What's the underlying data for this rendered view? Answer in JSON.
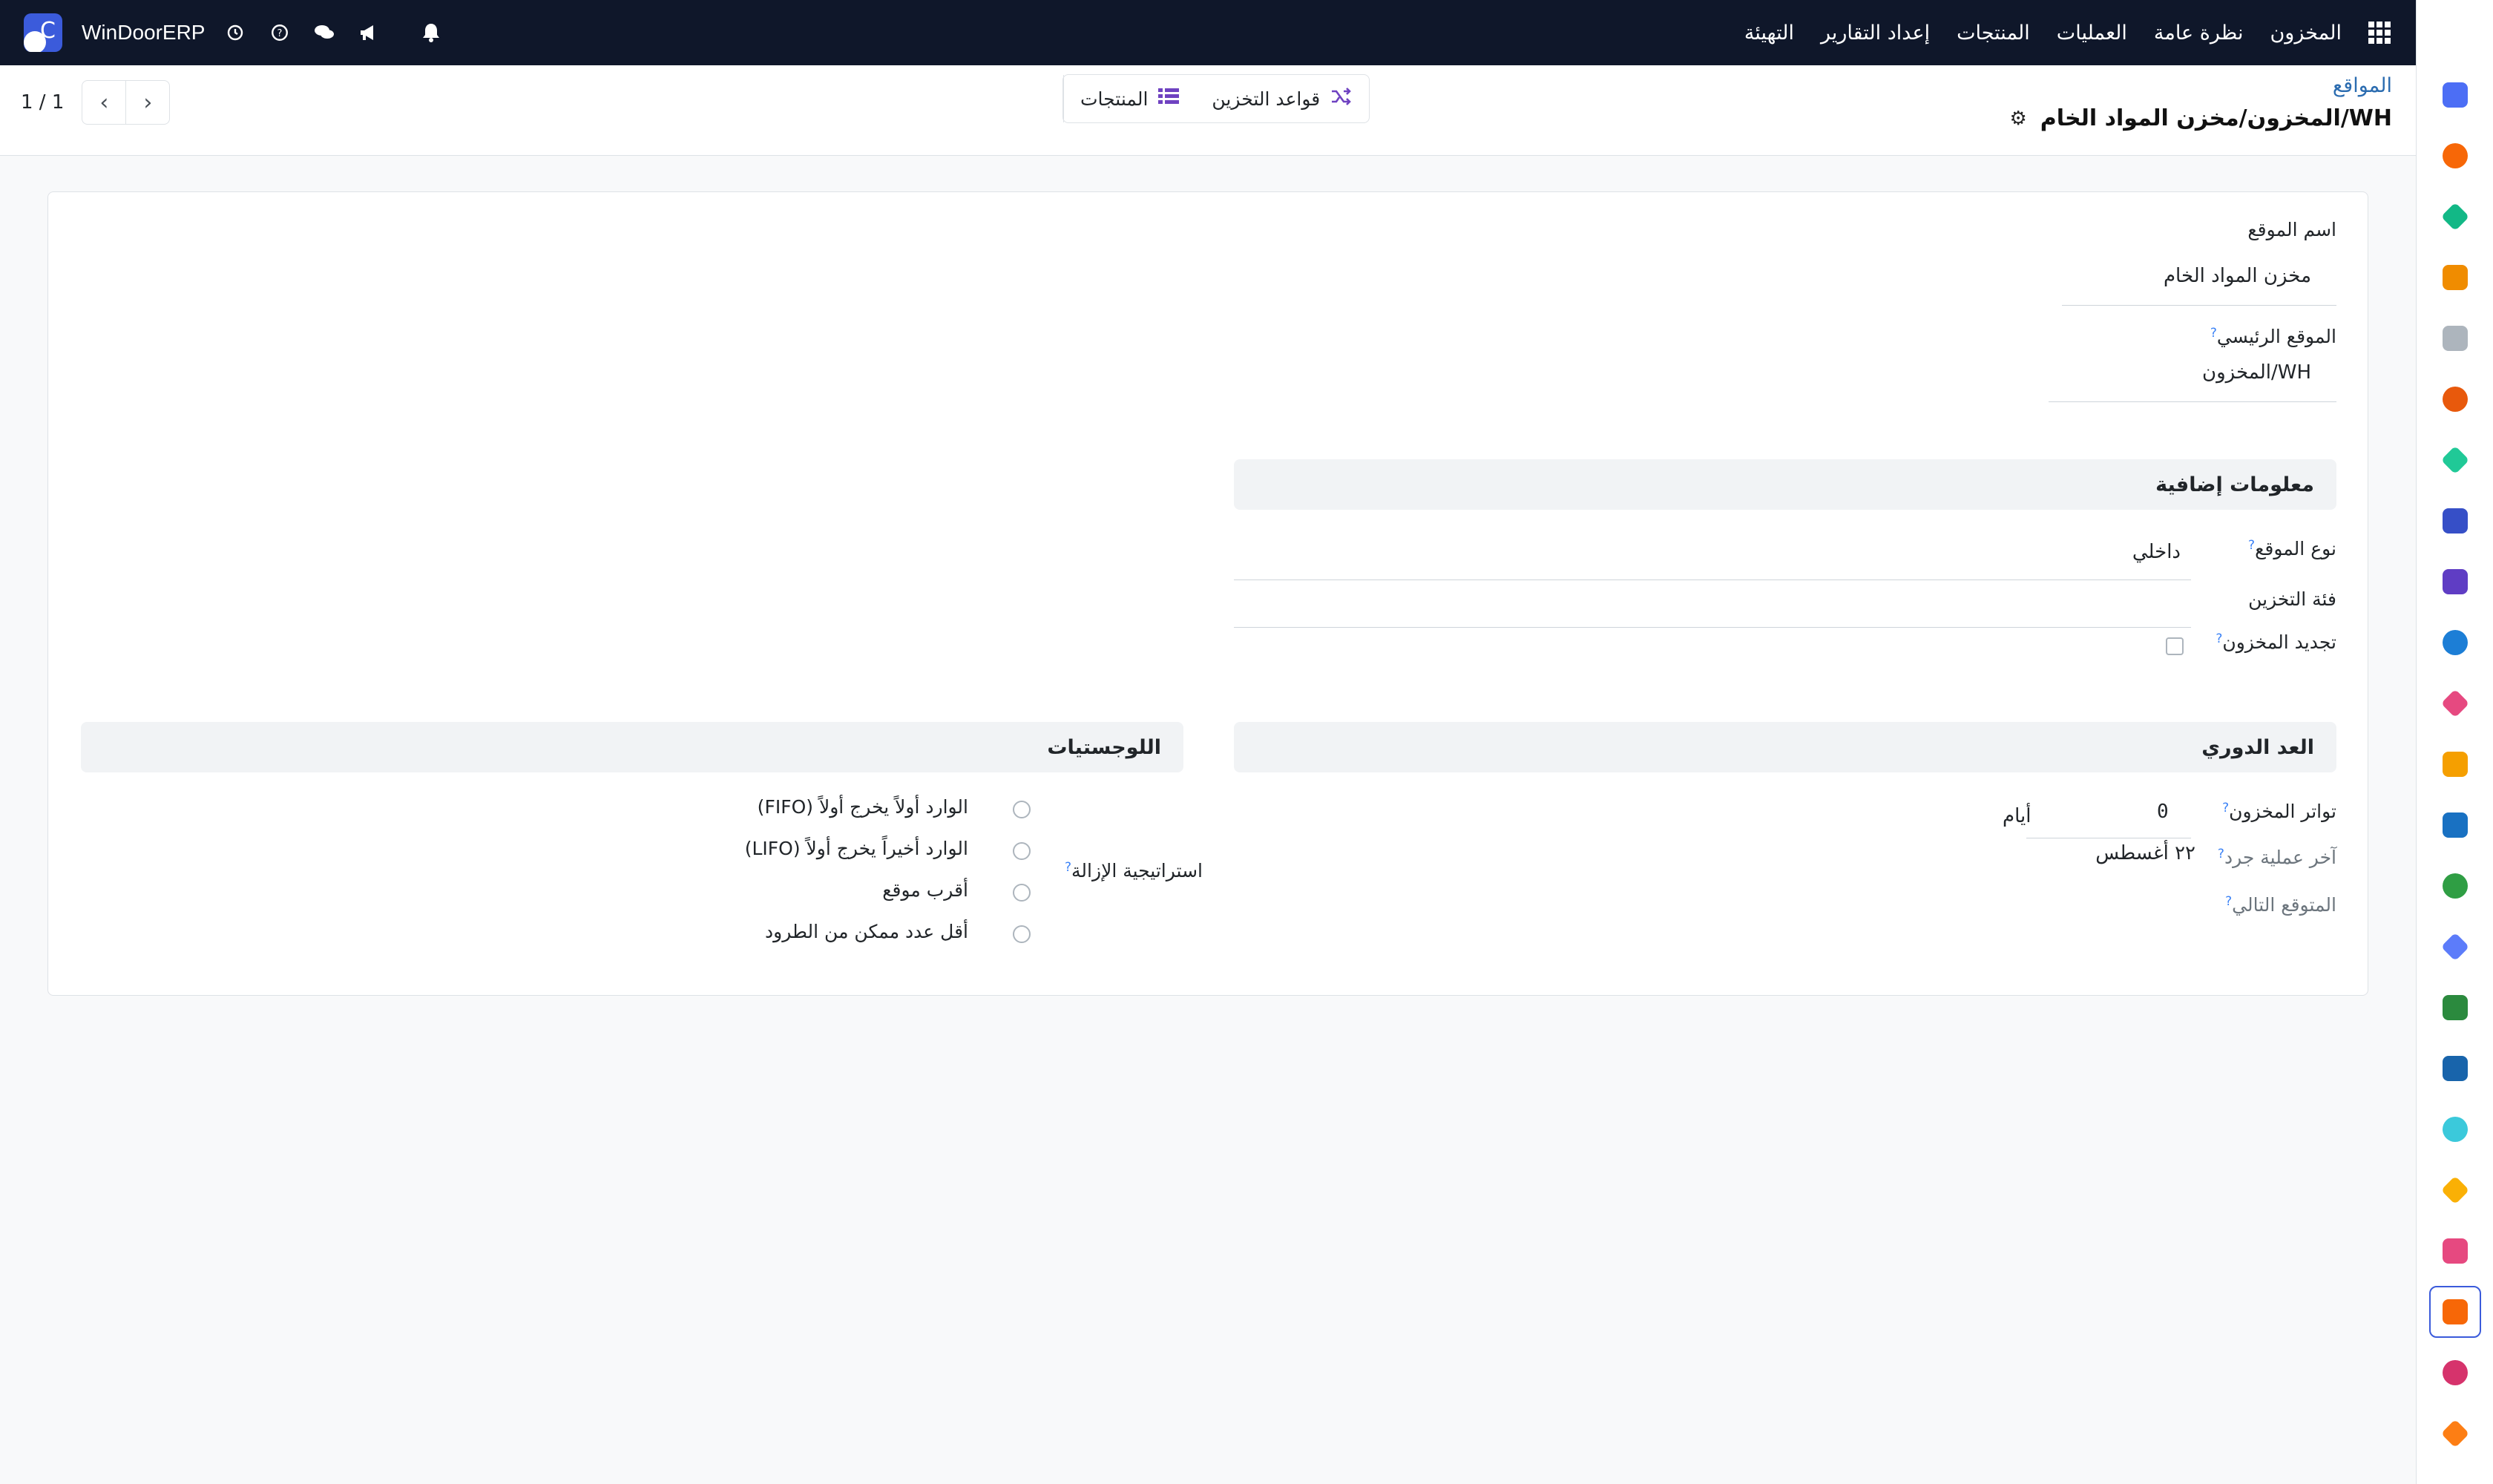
{
  "company": "WinDoorERP",
  "topbar": {
    "menu": [
      "المخزون",
      "نظرة عامة",
      "العمليات",
      "المنتجات",
      "إعداد التقارير",
      "التهيئة"
    ]
  },
  "breadcrumb": {
    "parent": "المواقع",
    "current": "WH/المخزون/مخزن المواد الخام"
  },
  "smart_buttons": {
    "storage_rules": "قواعد التخزين",
    "products": "المنتجات"
  },
  "pager": {
    "value": "1 / 1"
  },
  "form": {
    "location_name_label": "اسم الموقع",
    "location_name": "مخزن المواد الخام",
    "parent_location_label": "الموقع الرئيسي",
    "parent_location": "WH/المخزون",
    "additional_info": {
      "title": "معلومات إضافية",
      "location_type_label": "نوع الموقع",
      "location_type": "داخلي",
      "storage_category_label": "فئة التخزين",
      "storage_category": "",
      "replenish_label": "تجديد المخزون"
    },
    "cyclic_count": {
      "title": "العد الدوري",
      "frequency_label": "تواتر المخزون",
      "frequency_value": "0",
      "frequency_unit": "أيام",
      "last_count_label": "آخر عملية جرد",
      "last_count_value": "٢٢ أغسطس",
      "next_expected_label": "المتوقع التالي"
    },
    "logistics": {
      "title": "اللوجستيات",
      "removal_strategy_label": "استراتيجية الإزالة",
      "options": [
        "الوارد أولاً يخرج أولاً (FIFO)",
        "الوارد أخيراً يخرج أولاً (LIFO)",
        "أقرب موقع",
        "أقل عدد ممكن من الطرود"
      ]
    },
    "help_mark": "?"
  },
  "colors": {
    "navbar": "#0f172a",
    "accent": "#3b5bdb",
    "link": "#2b6cb0",
    "help": "#3b82f6"
  },
  "sidebar_icons": [
    {
      "name": "mail-app-icon",
      "color": "#4c6ef5"
    },
    {
      "name": "chat-bubble-app-icon",
      "color": "#f76707"
    },
    {
      "name": "funnel-app-icon",
      "color": "#12b886"
    },
    {
      "name": "bar-chart-app-icon",
      "color": "#f08c00"
    },
    {
      "name": "box-app-icon",
      "color": "#adb5bd"
    },
    {
      "name": "inventory-app-icon",
      "color": "#e8590c"
    },
    {
      "name": "check-app-icon",
      "color": "#20c997"
    },
    {
      "name": "book-app-icon",
      "color": "#364fc7"
    },
    {
      "name": "package-app-icon",
      "color": "#5f3dc4"
    },
    {
      "name": "invoice-app-icon",
      "color": "#1c7ed6"
    },
    {
      "name": "users-app-icon",
      "color": "#e64980"
    },
    {
      "name": "calendar-app-icon",
      "color": "#f59f00"
    },
    {
      "name": "sign-app-icon",
      "color": "#1971c2"
    },
    {
      "name": "contacts-app-icon",
      "color": "#2f9e44"
    },
    {
      "name": "dashboard-app-icon",
      "color": "#5c7cfa"
    },
    {
      "name": "whatsapp-app-icon",
      "color": "#2b8a3e"
    },
    {
      "name": "clock-app-icon",
      "color": "#1864ab"
    },
    {
      "name": "wave-app-icon",
      "color": "#3bc9db"
    },
    {
      "name": "send-app-icon",
      "color": "#fab005"
    },
    {
      "name": "card-app-icon",
      "color": "#e64980"
    },
    {
      "name": "cube-app-icon",
      "color": "#f76707"
    },
    {
      "name": "pie-app-icon",
      "color": "#d6336c"
    },
    {
      "name": "hexagon-app-icon",
      "color": "#fd7e14"
    }
  ]
}
